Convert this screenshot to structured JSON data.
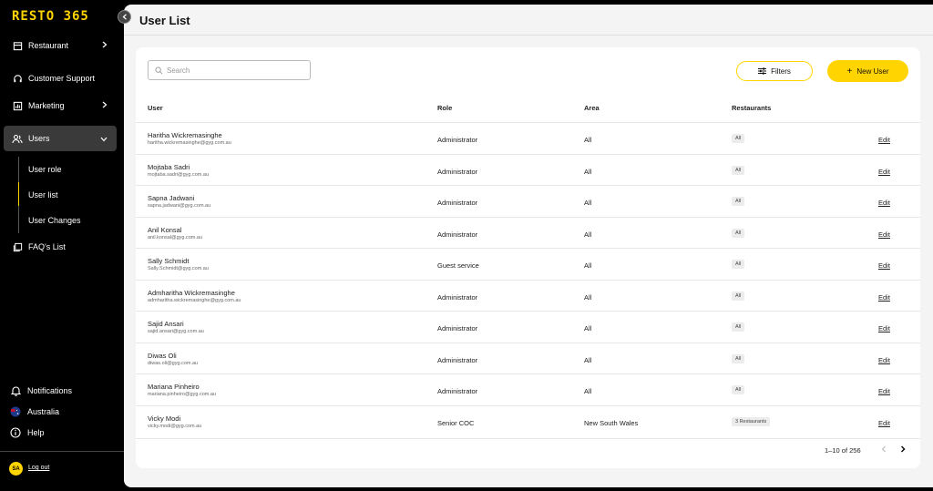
{
  "app": {
    "logo": "RESTO 365"
  },
  "sidebar": {
    "items": [
      {
        "label": "Restaurant",
        "icon": "storefront-icon",
        "has_chevron": true
      },
      {
        "label": "Customer Support",
        "icon": "headset-icon",
        "has_chevron": false
      },
      {
        "label": "Marketing",
        "icon": "chart-icon",
        "has_chevron": true
      },
      {
        "label": "Users",
        "icon": "users-icon",
        "has_chevron": true,
        "active": true
      },
      {
        "label": "FAQ's List",
        "icon": "faq-icon",
        "has_chevron": false
      }
    ],
    "users_submenu": [
      "User role",
      "User list",
      "User Changes"
    ],
    "active_submenu": "User list",
    "bottom": {
      "notifications": "Notifications",
      "region": "Australia",
      "help": "Help",
      "avatar_initials": "SA",
      "logout": "Log out"
    }
  },
  "page": {
    "title": "User List"
  },
  "toolbar": {
    "search_placeholder": "Search",
    "filters_label": "Filters",
    "new_user_label": "New User"
  },
  "table": {
    "headers": {
      "user": "User",
      "role": "Role",
      "area": "Area",
      "restaurants": "Restaurants"
    },
    "rows": [
      {
        "name": "Haritha Wickremasinghe",
        "email": "haritha.wickremasinghe@gyg.com.au",
        "role": "Administrator",
        "area": "All",
        "restaurants": "All",
        "action": "Edit"
      },
      {
        "name": "Mojtaba Sadri",
        "email": "mojtaba.sadri@gyg.com.au",
        "role": "Administrator",
        "area": "All",
        "restaurants": "All",
        "action": "Edit"
      },
      {
        "name": "Sapna Jadwani",
        "email": "sapna.jadwani@gyg.com.au",
        "role": "Administrator",
        "area": "All",
        "restaurants": "All",
        "action": "Edit"
      },
      {
        "name": "Anil Konsal",
        "email": "anil.konsal@gyg.com.au",
        "role": "Administrator",
        "area": "All",
        "restaurants": "All",
        "action": "Edit"
      },
      {
        "name": "Sally Schmidt",
        "email": "Sally.Schmidt@gyg.com.au",
        "role": "Guest service",
        "area": "All",
        "restaurants": "All",
        "action": "Edit"
      },
      {
        "name": "Admharitha Wickremasinghe",
        "email": "admharitha.wickremasinghe@gyg.com.au",
        "role": "Administrator",
        "area": "All",
        "restaurants": "All",
        "action": "Edit"
      },
      {
        "name": "Sajid Ansari",
        "email": "sajid.ansari@gyg.com.au",
        "role": "Administrator",
        "area": "All",
        "restaurants": "All",
        "action": "Edit"
      },
      {
        "name": "Diwas Oli",
        "email": "diwas.oli@gyg.com.au",
        "role": "Administrator",
        "area": "All",
        "restaurants": "All",
        "action": "Edit"
      },
      {
        "name": "Mariana Pinheiro",
        "email": "mariana.pinheiro@gyg.com.au",
        "role": "Administrator",
        "area": "All",
        "restaurants": "All",
        "action": "Edit"
      },
      {
        "name": "Vicky Modi",
        "email": "vicky.modi@gyg.com.au",
        "role": "Senior COC",
        "area": "New South Wales",
        "restaurants": "3 Restaurants",
        "action": "Edit"
      }
    ]
  },
  "pagination": {
    "range": "1–10 of 256"
  },
  "colors": {
    "accent": "#FFD400",
    "sidebar_bg": "#000000",
    "active_item_bg": "#3a3a3a"
  }
}
